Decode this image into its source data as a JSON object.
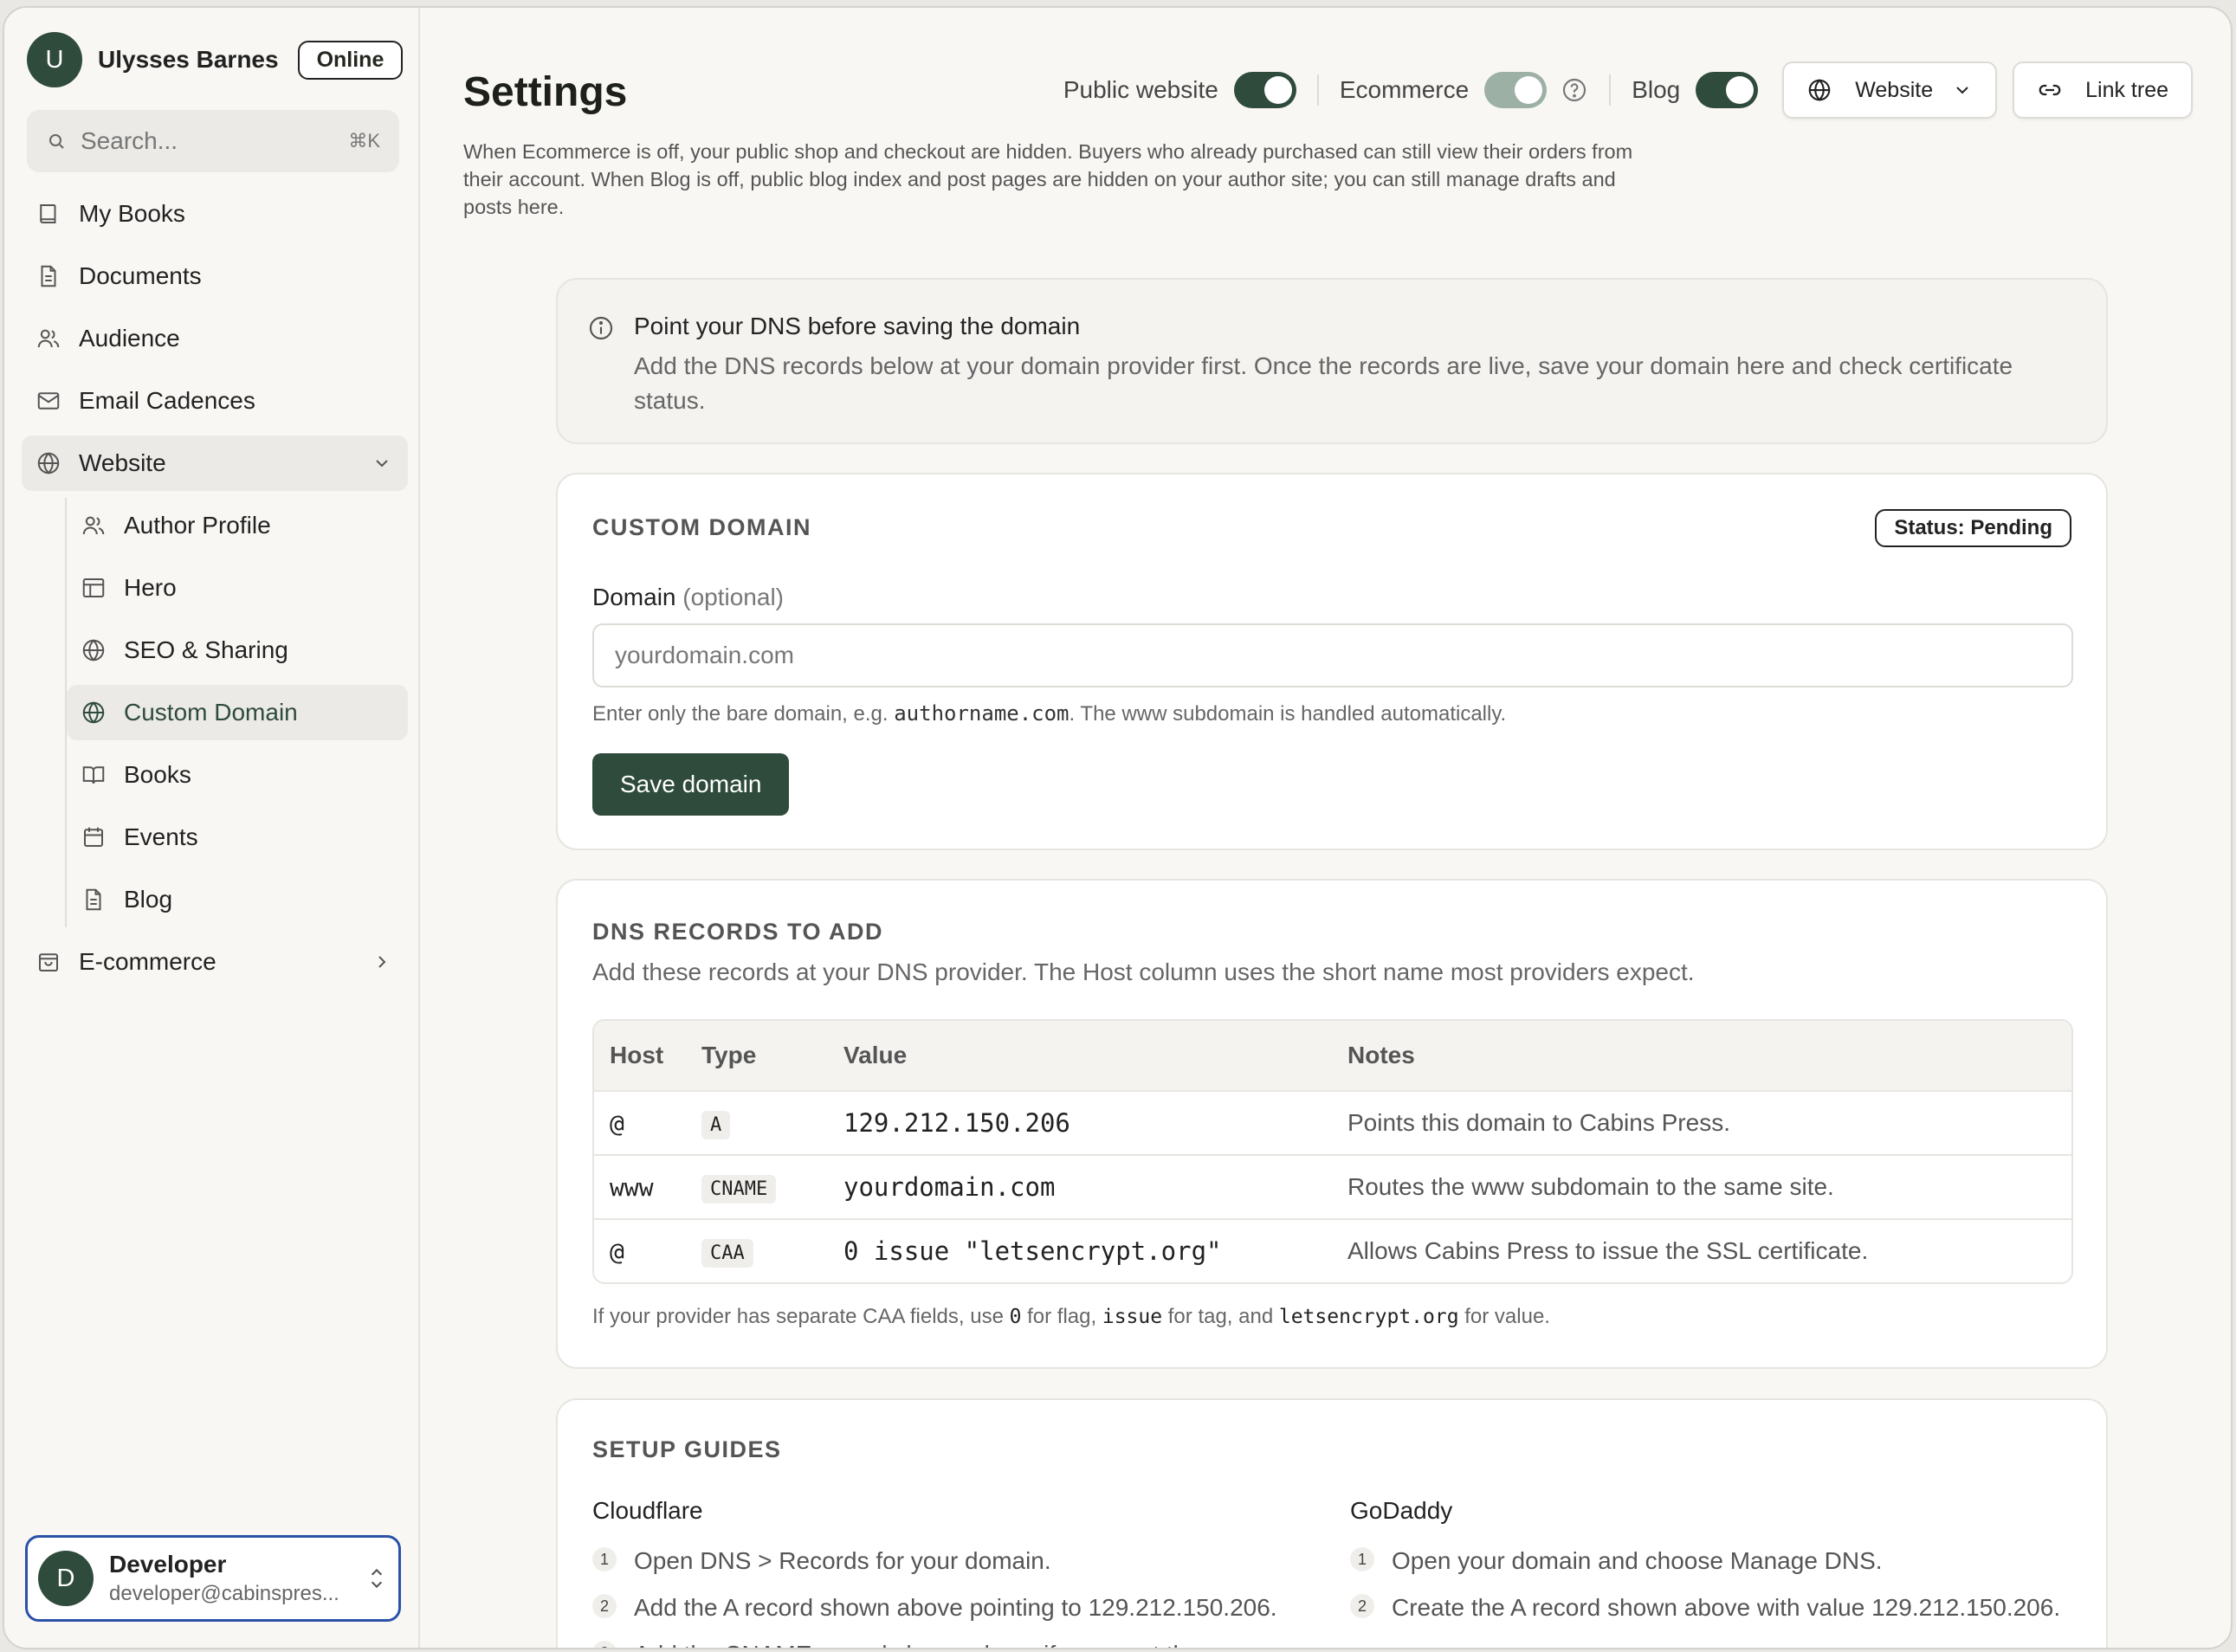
{
  "user": {
    "initial": "U",
    "name": "Ulysses Barnes",
    "status": "Online"
  },
  "search": {
    "placeholder": "Search...",
    "shortcut": "⌘K"
  },
  "nav": {
    "my_books": "My Books",
    "documents": "Documents",
    "audience": "Audience",
    "email_cadences": "Email Cadences",
    "website": "Website",
    "website_sub": {
      "author_profile": "Author Profile",
      "hero": "Hero",
      "seo_sharing": "SEO & Sharing",
      "custom_domain": "Custom Domain",
      "books": "Books",
      "events": "Events",
      "blog": "Blog"
    },
    "ecommerce": "E-commerce"
  },
  "account": {
    "initial": "D",
    "name": "Developer",
    "email": "developer@cabinspres..."
  },
  "header": {
    "title": "Settings",
    "public_website_label": "Public website",
    "ecommerce_label": "Ecommerce",
    "blog_label": "Blog",
    "website_button": "Website",
    "link_tree_button": "Link tree",
    "description": "When Ecommerce is off, your public shop and checkout are hidden. Buyers who already purchased can still view their orders from their account. When Blog is off, public blog index and post pages are hidden on your author site; you can still manage drafts and posts here."
  },
  "toggles": {
    "public_website": true,
    "ecommerce": true,
    "blog": true
  },
  "info": {
    "title": "Point your DNS before saving the domain",
    "body": "Add the DNS records below at your domain provider first. Once the records are live, save your domain here and check certificate status."
  },
  "custom_domain": {
    "section_title": "CUSTOM DOMAIN",
    "status": "Status: Pending",
    "label": "Domain",
    "label_optional": "(optional)",
    "placeholder": "yourdomain.com",
    "hint_pre": "Enter only the bare domain, e.g.",
    "hint_code": "authorname.com",
    "hint_post": ". The www subdomain is handled automatically.",
    "save_label": "Save domain"
  },
  "dns": {
    "section_title": "DNS RECORDS TO ADD",
    "subtitle": "Add these records at your DNS provider. The Host column uses the short name most providers expect.",
    "headers": [
      "Host",
      "Type",
      "Value",
      "Notes"
    ],
    "rows": [
      {
        "host": "@",
        "type": "A",
        "value": "129.212.150.206",
        "notes": "Points this domain to Cabins Press."
      },
      {
        "host": "www",
        "type": "CNAME",
        "value": "yourdomain.com",
        "notes": "Routes the www subdomain to the same site."
      },
      {
        "host": "@",
        "type": "CAA",
        "value": "0 issue \"letsencrypt.org\"",
        "notes": "Allows Cabins Press to issue the SSL certificate."
      }
    ],
    "caa_note": {
      "p1": "If your provider has separate CAA fields, use",
      "c1": "0",
      "p2": "for flag,",
      "c2": "issue",
      "p3": "for tag, and",
      "c3": "letsencrypt.org",
      "p4": "for value."
    }
  },
  "guides": {
    "section_title": "SETUP GUIDES",
    "cloudflare": {
      "title": "Cloudflare",
      "steps": [
        "Open DNS > Records for your domain.",
        "Add the A record shown above pointing to 129.212.150.206.",
        "Add the CNAME record shown above if you want the"
      ]
    },
    "godaddy": {
      "title": "GoDaddy",
      "steps": [
        "Open your domain and choose Manage DNS.",
        "Create the A record shown above with value 129.212.150.206."
      ]
    }
  },
  "icons": {
    "book": "book-icon",
    "document": "document-icon",
    "users": "users-icon",
    "mail": "mail-icon",
    "globe": "globe-icon",
    "layout": "layout-icon",
    "calendar": "calendar-icon",
    "bag": "shopping-bag-icon",
    "link": "link-icon",
    "info": "info-icon",
    "help": "help-icon",
    "search": "search-icon"
  },
  "colors": {
    "accent": "#2f4b3c",
    "focus_ring": "#2a52a8",
    "background": "#f8f7f4"
  }
}
